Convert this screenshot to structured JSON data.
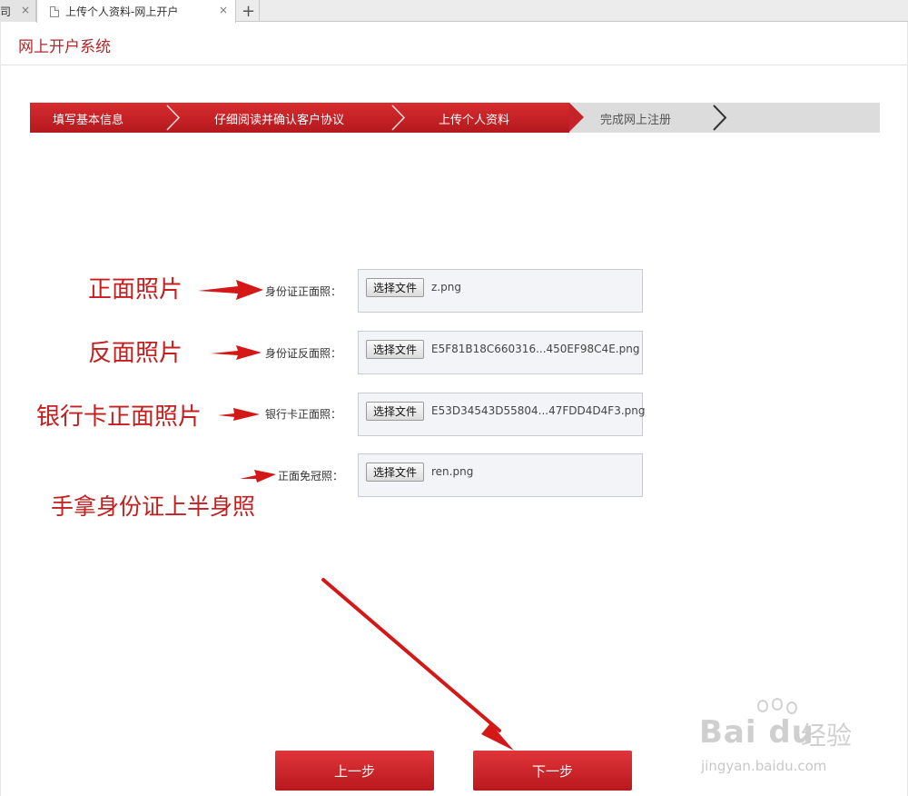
{
  "browser": {
    "inactive_tab_fragment": "司",
    "active_tab_title": "上传个人资料-网上开户",
    "close_glyph": "×",
    "new_tab_glyph": "+"
  },
  "header": {
    "title": "网上开户系统"
  },
  "stepper": {
    "steps": [
      {
        "label": "填写基本信息",
        "state": "done"
      },
      {
        "label": "仔细阅读并确认客户协议",
        "state": "done"
      },
      {
        "label": "上传个人资料",
        "state": "current"
      },
      {
        "label": "完成网上注册",
        "state": "pending"
      }
    ]
  },
  "upload_rows": [
    {
      "label": "身份证正面照：",
      "button_label": "选择文件",
      "file_name": "z.png"
    },
    {
      "label": "身份证反面照：",
      "button_label": "选择文件",
      "file_name": "E5F81B18C660316...450EF98C4E.png"
    },
    {
      "label": "银行卡正面照：",
      "button_label": "选择文件",
      "file_name": "E53D34543D55804...47FDD4D4F3.png"
    },
    {
      "label": "正面免冠照：",
      "button_label": "选择文件",
      "file_name": "ren.png"
    }
  ],
  "annotations": [
    {
      "text": "正面照片"
    },
    {
      "text": "反面照片"
    },
    {
      "text": "银行卡正面照片"
    },
    {
      "text": "手拿身份证上半身照"
    }
  ],
  "actions": {
    "prev_label": "上一步",
    "next_label": "下一步"
  },
  "watermark": {
    "logo_text": "Bai du",
    "cn_text": "经验",
    "url": "jingyan.baidu.com"
  },
  "colors": {
    "brand_red": "#c41e1e",
    "step_active": "#c5222a",
    "step_pending": "#dcdcdc"
  }
}
